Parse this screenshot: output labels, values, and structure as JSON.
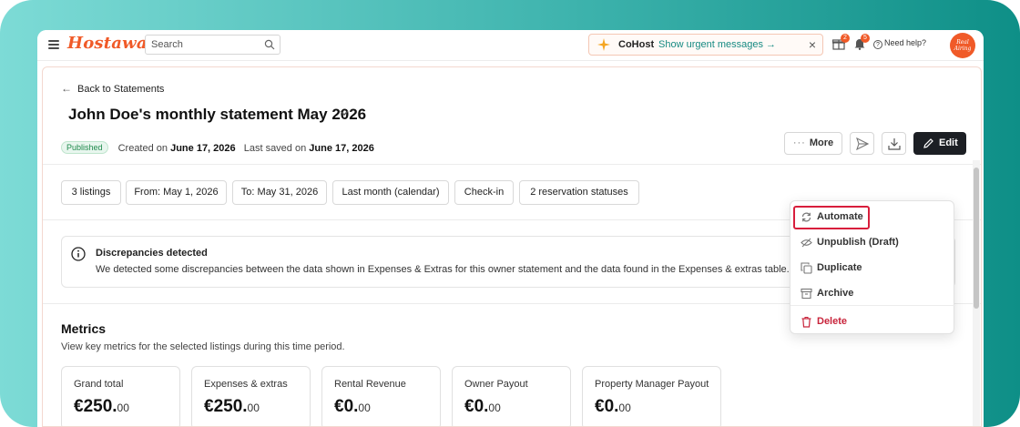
{
  "app": {
    "logo_text": "Hostaway",
    "search_placeholder": "Search",
    "cohost": {
      "name": "CoHost",
      "link": "Show urgent messages →",
      "close": "×"
    },
    "gift_badge": "2",
    "bell_badge": "5",
    "help_label": "Need help?",
    "avatar_text": "Real Airing"
  },
  "page": {
    "back_label": "Back to Statements",
    "title": "John Doe's monthly statement May 2026",
    "status": "Published",
    "created_label": "Created on",
    "created_date": "June 17, 2026",
    "saved_label": "Last saved on",
    "saved_date": "June 17, 2026",
    "more_label": "More",
    "edit_label": "Edit"
  },
  "filters": [
    "3 listings",
    "From: May 1, 2026",
    "To: May 31, 2026",
    "Last month (calendar)",
    "Check-in",
    "2 reservation statuses"
  ],
  "alert": {
    "title": "Discrepancies detected",
    "message": "We detected some discrepancies between the data shown in Expenses & Extras for this owner statement and the data found in the Expenses & extras table."
  },
  "metrics": {
    "title": "Metrics",
    "subtitle": "View key metrics for the selected listings during this time period.",
    "cards": [
      {
        "label": "Grand total",
        "value": "€250.",
        "cents": "00"
      },
      {
        "label": "Expenses & extras",
        "value": "€250.",
        "cents": "00"
      },
      {
        "label": "Rental Revenue",
        "value": "€0.",
        "cents": "00"
      },
      {
        "label": "Owner Payout",
        "value": "€0.",
        "cents": "00"
      },
      {
        "label": "Property Manager Payout",
        "value": "€0.",
        "cents": "00"
      }
    ]
  },
  "menu": {
    "items": [
      {
        "label": "Automate",
        "icon": "refresh-icon"
      },
      {
        "label": "Unpublish (Draft)",
        "icon": "eye-off-icon"
      },
      {
        "label": "Duplicate",
        "icon": "copy-icon"
      },
      {
        "label": "Archive",
        "icon": "archive-icon"
      },
      {
        "label": "Delete",
        "icon": "trash-icon"
      }
    ]
  },
  "colors": {
    "brand": "#f05a28",
    "accent_teal": "#168a82",
    "highlight_red": "#d81e3c",
    "danger": "#c8243b",
    "edit_dark": "#1c1f24"
  }
}
